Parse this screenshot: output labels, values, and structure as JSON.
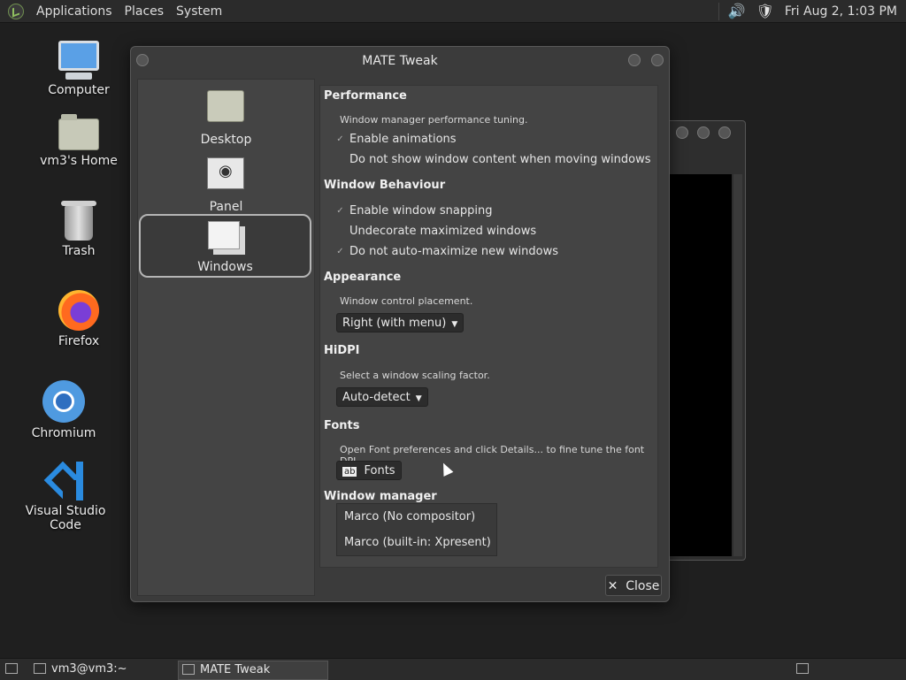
{
  "topbar": {
    "menus": [
      "Applications",
      "Places",
      "System"
    ],
    "datetime": "Fri Aug  2,  1:03 PM",
    "tray_icons": [
      "volume-icon",
      "shield-icon"
    ]
  },
  "desktop_icons": [
    {
      "label": "Computer",
      "icon": "computer-icon"
    },
    {
      "label": "vm3's Home",
      "icon": "home-folder-icon"
    },
    {
      "label": "Trash",
      "icon": "trash-icon"
    },
    {
      "label": "Firefox",
      "icon": "firefox-icon"
    },
    {
      "label": "Chromium",
      "icon": "chromium-icon"
    },
    {
      "label": "Visual Studio Code",
      "icon": "vscode-icon"
    }
  ],
  "window": {
    "title": "MATE Tweak",
    "sidebar": [
      {
        "label": "Desktop",
        "selected": false
      },
      {
        "label": "Panel",
        "selected": false
      },
      {
        "label": "Windows",
        "selected": true
      }
    ],
    "performance": {
      "heading": "Performance",
      "desc": "Window manager performance tuning.",
      "options": [
        {
          "label": "Enable animations",
          "checked": true
        },
        {
          "label": "Do not show window content when moving windows",
          "checked": false
        }
      ]
    },
    "behaviour": {
      "heading": "Window Behaviour",
      "options": [
        {
          "label": "Enable window snapping",
          "checked": true
        },
        {
          "label": "Undecorate maximized windows",
          "checked": false
        },
        {
          "label": "Do not auto-maximize new windows",
          "checked": true
        }
      ]
    },
    "appearance": {
      "heading": "Appearance",
      "desc": "Window control placement.",
      "value": "Right (with menu)"
    },
    "hidpi": {
      "heading": "HiDPI",
      "desc": "Select a window scaling factor.",
      "value": "Auto-detect"
    },
    "fonts": {
      "heading": "Fonts",
      "desc": "Open Font preferences and click Details... to fine tune the font DPI.",
      "button": "Fonts"
    },
    "wm": {
      "heading": "Window manager",
      "options": [
        "Marco (No compositor)",
        "Marco (built-in: Xpresent)"
      ]
    },
    "close_label": "Close"
  },
  "taskbar": {
    "tasks": [
      "vm3@vm3:~",
      "MATE Tweak"
    ]
  }
}
